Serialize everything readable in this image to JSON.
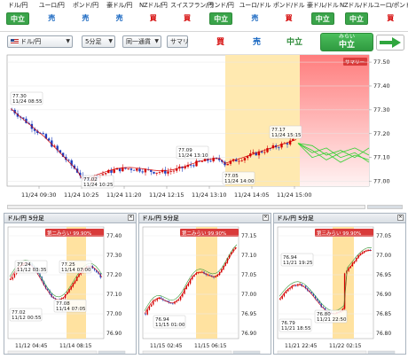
{
  "signals": [
    {
      "pair": "ドル/円",
      "signal": "中立",
      "type": "neu"
    },
    {
      "pair": "ユーロ/円",
      "signal": "売",
      "type": "sell"
    },
    {
      "pair": "ポンド/円",
      "signal": "売",
      "type": "sell"
    },
    {
      "pair": "豪ドル/円",
      "signal": "売",
      "type": "sell"
    },
    {
      "pair": "NZドル/円",
      "signal": "買",
      "type": "buy"
    },
    {
      "pair": "スイスフラン/円",
      "signal": "買",
      "type": "buy"
    },
    {
      "pair": "ランド/円",
      "signal": "中立",
      "type": "neu"
    },
    {
      "pair": "ユーロ/ドル",
      "signal": "売",
      "type": "sell"
    },
    {
      "pair": "ポンド/ドル",
      "signal": "買",
      "type": "buy"
    },
    {
      "pair": "豪ドル/ドル",
      "signal": "中立",
      "type": "neu"
    },
    {
      "pair": "NZドル/ドル",
      "signal": "中立",
      "type": "neu"
    },
    {
      "pair": "ユーロ/ポンド",
      "signal": "買",
      "type": "buy"
    }
  ],
  "controls": {
    "pair_select": "ドル/円",
    "interval_select": "5分足",
    "mode_select": "同一通貨",
    "summary_button": "サマリ",
    "buy_label": "買",
    "sell_label": "売",
    "neutral_label": "中立",
    "big_signal_caption": "みらい",
    "big_signal": "中立"
  },
  "colors": {
    "buy": "#d40000",
    "sell": "#1565c0",
    "neutral": "#3aa44a",
    "forecast": "#2fd12f",
    "highlight": "#ffe29a",
    "summary_zone": "#ff8a8a"
  },
  "main_chart": {
    "summary_tag": "サマリー",
    "y_ticks": [
      "77.50",
      "77.40",
      "77.30",
      "77.20",
      "77.10",
      "77.00"
    ],
    "x_ticks": [
      "11/24 09:30",
      "11/24 10:25",
      "11/24 11:20",
      "11/24 12:15",
      "11/24 13:10",
      "11/24 14:05",
      "11/24 15:00"
    ],
    "annotations": [
      {
        "price": "77.30",
        "time": "11/24 08:55"
      },
      {
        "price": "77.02",
        "time": "11/24 10:25"
      },
      {
        "price": "77.09",
        "time": "11/24 13:10"
      },
      {
        "price": "77.05",
        "time": "11/24 14:00"
      },
      {
        "price": "77.17",
        "time": "11/24 15:15"
      }
    ]
  },
  "sub_charts": [
    {
      "title": "ドル/円 5分足",
      "badge": "第二みらい 99.90%",
      "y_ticks": [
        "77.40",
        "77.30",
        "77.20",
        "77.10",
        "77.00",
        "76.90"
      ],
      "x_ticks": [
        "11/12 04:45",
        "11/14 08:15"
      ],
      "annotations": [
        {
          "price": "77.24",
          "time": "11/12 03:35"
        },
        {
          "price": "77.25",
          "time": "11/14 07:00"
        },
        {
          "price": "77.02",
          "time": "11/12 00:55"
        },
        {
          "price": "77.08",
          "time": "11/14 07:05"
        }
      ]
    },
    {
      "title": "ドル/円 5分足",
      "badge": "第二みらい 99.90%",
      "y_ticks": [
        "77.15",
        "77.10",
        "77.05",
        "77.00",
        "76.95",
        "76.90"
      ],
      "x_ticks": [
        "11/15 02:45",
        "11/15 06:15"
      ],
      "annotations": [
        {
          "price": "76.94",
          "time": "11/15 01:00"
        }
      ]
    },
    {
      "title": "ドル/円 5分足",
      "badge": "第三みらい 99.90%",
      "y_ticks": [
        "77.05",
        "77.00",
        "76.95",
        "76.90",
        "76.85",
        "76.80"
      ],
      "x_ticks": [
        "11/21 22:45",
        "11/22 02:15"
      ],
      "annotations": [
        {
          "price": "76.94",
          "time": "11/21 19:25"
        },
        {
          "price": "76.80",
          "time": "11/21 22:50"
        },
        {
          "price": "76.79",
          "time": "11/21 18:55"
        }
      ]
    }
  ]
}
